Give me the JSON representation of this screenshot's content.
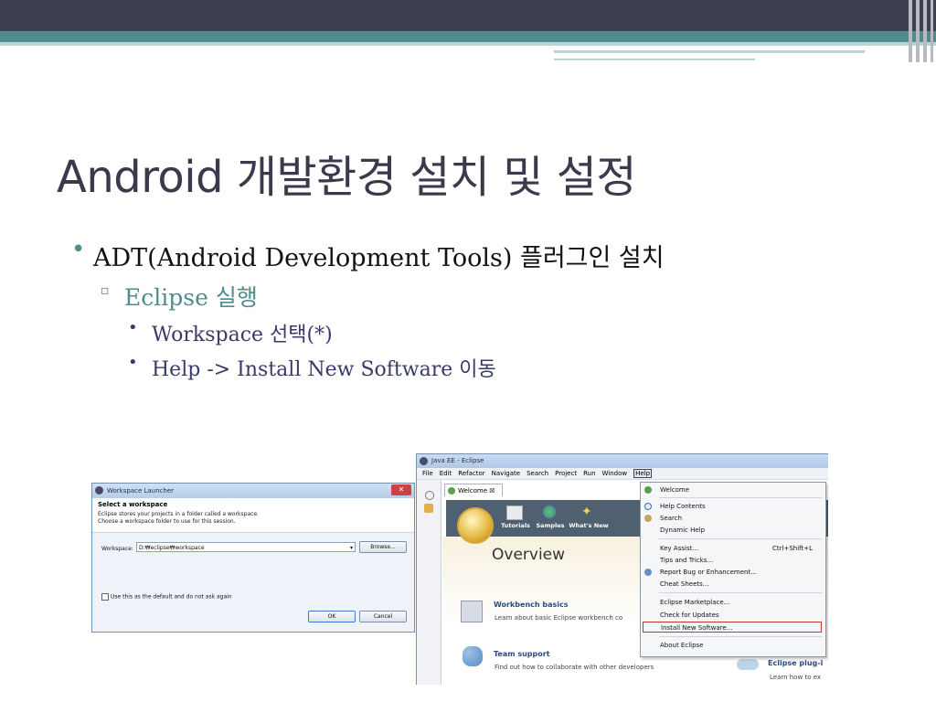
{
  "slide": {
    "title": "Android 개발환경 설치 및 설정",
    "bullets": {
      "l1": "ADT(Android Development Tools) 플러그인 설치",
      "l2": "Eclipse 실행",
      "l3a": "Workspace 선택(*)",
      "l3b": "Help -> Install New Software 이동"
    },
    "bullet_glyphs": {
      "l1": "•",
      "l2": "▫",
      "l3": "•"
    }
  },
  "workspace_dialog": {
    "title": "Workspace Launcher",
    "close": "✕",
    "heading": "Select a workspace",
    "desc1": "Eclipse stores your projects in a folder called a workspace.",
    "desc2": "Choose a workspace folder to use for this session.",
    "workspace_label": "Workspace:",
    "workspace_value": "D:₩eclipse₩workspace",
    "browse": "Browse...",
    "checkbox_label": "Use this as the default and do not ask again",
    "ok": "OK",
    "cancel": "Cancel"
  },
  "eclipse": {
    "title": "Java EE - Eclipse",
    "menus": [
      "File",
      "Edit",
      "Refactor",
      "Navigate",
      "Search",
      "Project",
      "Run",
      "Window",
      "Help"
    ],
    "tab": "Welcome ☒",
    "banner_items": [
      "Tutorials",
      "Samples",
      "What's New"
    ],
    "overview": "Overview",
    "sections": [
      {
        "title": "Workbench basics",
        "desc": "Learn about basic Eclipse workbench co"
      },
      {
        "title": "Team support",
        "desc": "Find out how to collaborate with other developers"
      },
      {
        "title": "Eclipse plug-i",
        "desc": "Learn how to ex"
      }
    ],
    "help_menu": {
      "welcome": "Welcome",
      "help_contents": "Help Contents",
      "search": "Search",
      "dynamic_help": "Dynamic Help",
      "key_assist": "Key Assist...",
      "key_assist_accel": "Ctrl+Shift+L",
      "tips": "Tips and Tricks...",
      "report_bug": "Report Bug or Enhancement...",
      "cheat_sheets": "Cheat Sheets...",
      "marketplace": "Eclipse Marketplace...",
      "check_updates": "Check for Updates",
      "install_new": "Install New Software...",
      "about": "About Eclipse"
    }
  },
  "colors": {
    "teal": "#4f8c8e",
    "dark": "#3f3f52",
    "highlight_border": "#c0392b"
  }
}
